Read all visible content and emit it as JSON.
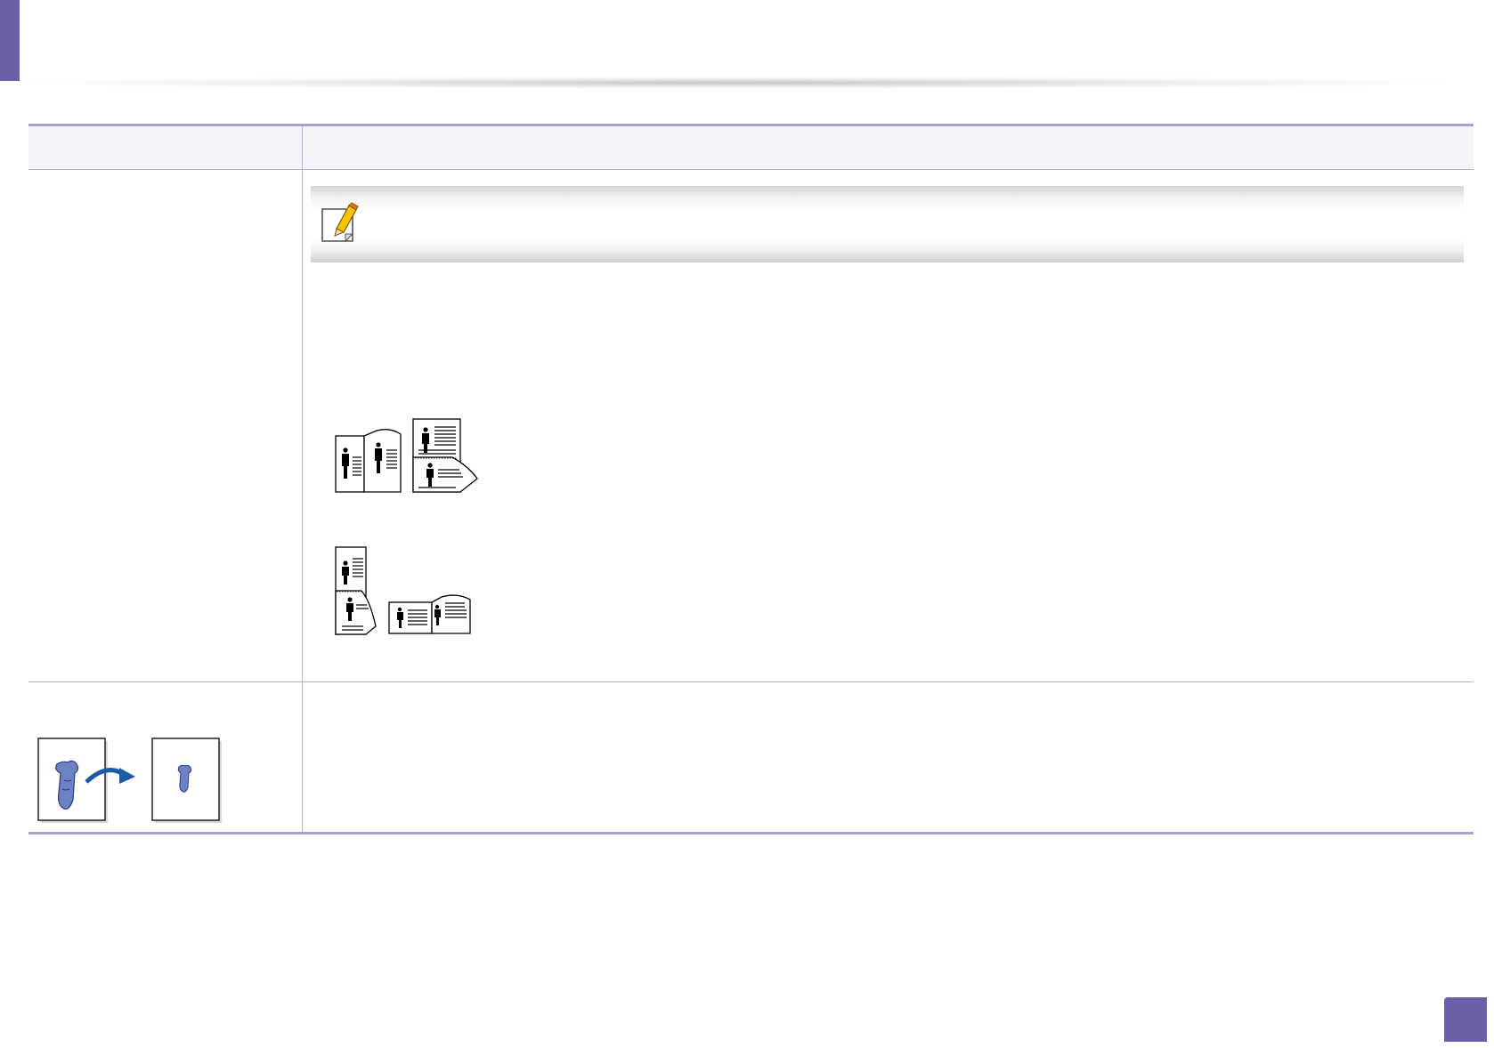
{
  "colors": {
    "accent": "#6a5fa8",
    "table_rule": "#a89fd0",
    "table_rule_thin": "#b8b2da",
    "header_row_bg": "#f4f3f8"
  },
  "icons": {
    "note": "note-pencil-icon",
    "duplex_long_edge": "duplex-long-edge-illustration",
    "duplex_short_edge": "duplex-short-edge-illustration",
    "reduce_enlarge": "reduce-enlarge-illustration"
  }
}
